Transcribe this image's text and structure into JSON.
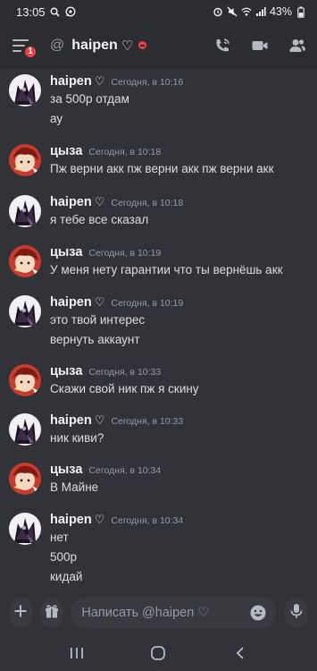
{
  "status_bar": {
    "time": "13:05",
    "battery": "43%"
  },
  "header": {
    "at_symbol": "@",
    "channel_name": "haipen",
    "heart": "♡",
    "badge_count": "1"
  },
  "messages": [
    {
      "author": "haipen",
      "heart": "♡",
      "avatar": "haipen",
      "time": "Сегодня, в 10:16",
      "lines": [
        "за 500р отдам",
        "ау"
      ]
    },
    {
      "author": "цыза",
      "heart": "",
      "avatar": "cyza",
      "time": "Сегодня, в 10:18",
      "lines": [
        "Пж верни акк пж верни акк пж верни акк"
      ]
    },
    {
      "author": "haipen",
      "heart": "♡",
      "avatar": "haipen",
      "time": "Сегодня, в 10:18",
      "lines": [
        "я тебе все сказал"
      ]
    },
    {
      "author": "цыза",
      "heart": "",
      "avatar": "cyza",
      "time": "Сегодня, в 10:19",
      "lines": [
        "У меня нету гарантии что ты вернёшь акк"
      ]
    },
    {
      "author": "haipen",
      "heart": "♡",
      "avatar": "haipen",
      "time": "Сегодня, в 10:19",
      "lines": [
        "это твой интерес",
        "вернуть аккаунт"
      ]
    },
    {
      "author": "цыза",
      "heart": "",
      "avatar": "cyza",
      "time": "Сегодня, в 10:33",
      "lines": [
        "Скажи свой ник пж я скину"
      ]
    },
    {
      "author": "haipen",
      "heart": "♡",
      "avatar": "haipen",
      "time": "Сегодня, в 10:33",
      "lines": [
        "ник киви?"
      ]
    },
    {
      "author": "цыза",
      "heart": "",
      "avatar": "cyza",
      "time": "Сегодня, в 10:34",
      "lines": [
        "В Майне"
      ]
    },
    {
      "author": "haipen",
      "heart": "♡",
      "avatar": "haipen",
      "time": "Сегодня, в 10:34",
      "lines": [
        "нет",
        "500р",
        "кидай"
      ]
    }
  ],
  "composer": {
    "placeholder": "Написать @haipen ♡"
  },
  "icons": {
    "menu": "hamburger-menu-icon",
    "call": "phone-call-icon",
    "video": "video-camera-icon",
    "members": "members-icon",
    "add": "plus-icon",
    "gift": "gift-icon",
    "emoji": "emoji-icon",
    "mic": "microphone-icon"
  },
  "colors": {
    "background": "#313338",
    "header_bg": "#2b2d31",
    "badge_red": "#f23f43",
    "text_primary": "#f2f3f5",
    "text_muted": "#949ba4"
  }
}
